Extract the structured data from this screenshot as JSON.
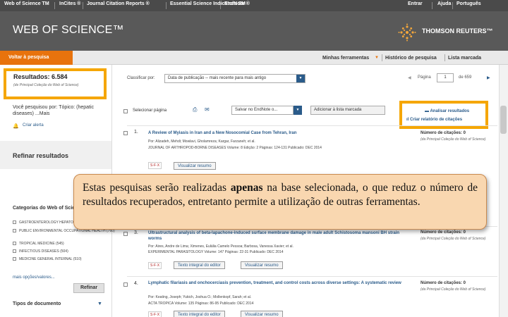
{
  "topnav": {
    "items": [
      "Web of Science TM",
      "InCites ®",
      "Journal Citation Reports ®",
      "Essential Science Indicators SM",
      "EndNote ®"
    ],
    "right": [
      "Entrar",
      "Ajuda",
      "Português"
    ]
  },
  "header": {
    "title": "WEB OF SCIENCE™",
    "brand": "THOMSON REUTERS™"
  },
  "subnav": {
    "back": "Voltar à pesquisa",
    "links": [
      "Minhas ferramentas",
      "Histórico de pesquisa",
      "Lista marcada"
    ]
  },
  "sidebar": {
    "results_title": "Resultados: 6.584",
    "results_sub": "(de Principal Coleção do Web of Science)",
    "searched_label": "Você pesquisou por: Tópico: (hepatic diseases) ...Mais",
    "alert": "Criar alerta",
    "refine_title": "Refinar resultados",
    "categories_title": "Categorias do Web of Science",
    "categories": [
      "GASTROENTEROLOGY HEPATOLOGY (1,948)",
      "PUBLIC ENVIRONMENTAL OCCUPATIONAL HEALTH (760)",
      "TROPICAL MEDICINE (545)",
      "INFECTIOUS DISEASES (504)",
      "MEDICINE GENERAL INTERNAL (510)"
    ],
    "more": "mais opções/valores...",
    "refine_button": "Refinar",
    "doc_types": "Tipos de documento"
  },
  "results": {
    "sort_label": "Classificar por:",
    "sort_value": "Data de publicação -- mais recente para mais antigo",
    "page_label": "Página",
    "page_value": "1",
    "page_total": "de 659",
    "select_page": "Selecionar página",
    "endnote": "Salvar no EndNote o...",
    "add_marked": "Adicionar à lista marcada",
    "analyze": "Analisar resultados",
    "citation_report": "Criar relatório de citações",
    "records": [
      {
        "num": "1.",
        "title": "A Review of Myiasis in Iran and a New Nosocomial Case from Tehran, Iran",
        "authors": "Por: Alizadeh, Mehdi; Mowlavi, Gholamreza; Kargar, Farzaneh; et al.",
        "source": "JOURNAL OF ARTHROPOD-BORNE DISEASES  Volume: 8  Edição: 2  Páginas: 124-131  Publicado: DEC 2014",
        "button": "Visualizar resumo",
        "cites": "Número de citações: 0",
        "cites_sub": "(da Principal Coleção do Web of Science)"
      },
      {
        "num": "3.",
        "title": "Ultrastructural analysis of beta-lapachone-induced surface membrane damage in male adult Schistosoma mansoni BH strain worms",
        "authors": "Por: Aires, Andre de Lima; Ximenes, Eulália Camelo Pessoa; Barbosa, Vanessa Xavier; et al.",
        "source": "EXPERIMENTAL PARASITOLOGY  Volume: 147  Páginas: 22-31  Publicado: DEC 2014",
        "button_fulltext": "Texto integral do editor",
        "button": "Visualizar resumo",
        "cites": "Número de citações: 0",
        "cites_sub": "(da Principal Coleção do Web of Science)"
      },
      {
        "num": "4.",
        "title": "Lymphatic filariasis and onchocerciasis prevention, treatment, and control costs across diverse settings: A systematic review",
        "authors": "Por: Keating, Joseph; Yukich, Joshua O.; Mollenkopf, Sarah; et al.",
        "source": "ACTA TROPICA  Volume: 135  Páginas: 86-95  Publicado: DEC 2014",
        "button_fulltext": "Texto integral do editor",
        "button": "Visualizar resumo",
        "cites": "Número de citações: 0",
        "cites_sub": "(da Principal Coleção do Web of Science)"
      }
    ]
  },
  "callout": {
    "before": "Estas pesquisas serão realizadas ",
    "bold": "apenas",
    "after": " na base selecionada, o que reduz o número de resultados recuperados, entretanto permite a utilização de outras ferramentas."
  },
  "colors": {
    "accent": "#e8730d",
    "highlight": "#f5a600",
    "header": "#595959",
    "link": "#2a5b8a",
    "callout": "#f9d7b0"
  }
}
